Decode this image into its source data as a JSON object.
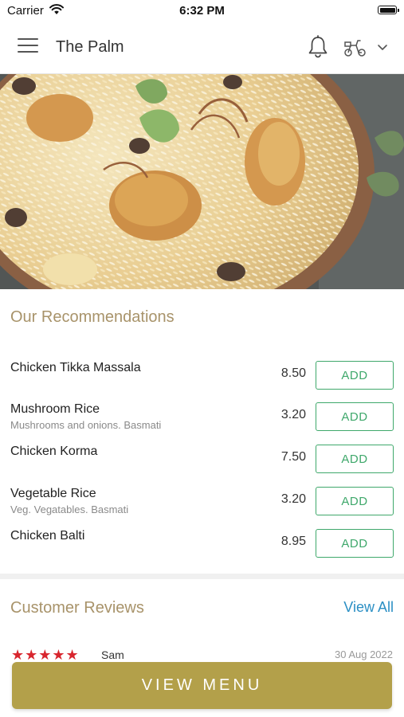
{
  "status_bar": {
    "carrier": "Carrier",
    "time": "6:32 PM"
  },
  "header": {
    "title": "The Palm"
  },
  "recommendations": {
    "title": "Our Recommendations",
    "add_label": "ADD",
    "items": [
      {
        "name": "Chicken Tikka Massala",
        "description": "",
        "price": "8.50"
      },
      {
        "name": "Mushroom Rice",
        "description": "Mushrooms and onions. Basmati",
        "price": "3.20"
      },
      {
        "name": "Chicken Korma",
        "description": "",
        "price": "7.50"
      },
      {
        "name": "Vegetable Rice",
        "description": "Veg. Vegatables. Basmati",
        "price": "3.20"
      },
      {
        "name": "Chicken Balti",
        "description": "",
        "price": "8.95"
      }
    ]
  },
  "reviews": {
    "title": "Customer Reviews",
    "view_all": "View All",
    "first_review": {
      "stars": "★★★★★",
      "rating": 5,
      "reviewer": "Sam",
      "date": "30 Aug 2022"
    }
  },
  "footer": {
    "view_menu_label": "VIEW MENU"
  },
  "colors": {
    "accent_gold": "#b3a04a",
    "section_title": "#a8936a",
    "add_green": "#3fa86b",
    "link_blue": "#2b8fc4",
    "star_red": "#d8262e"
  }
}
